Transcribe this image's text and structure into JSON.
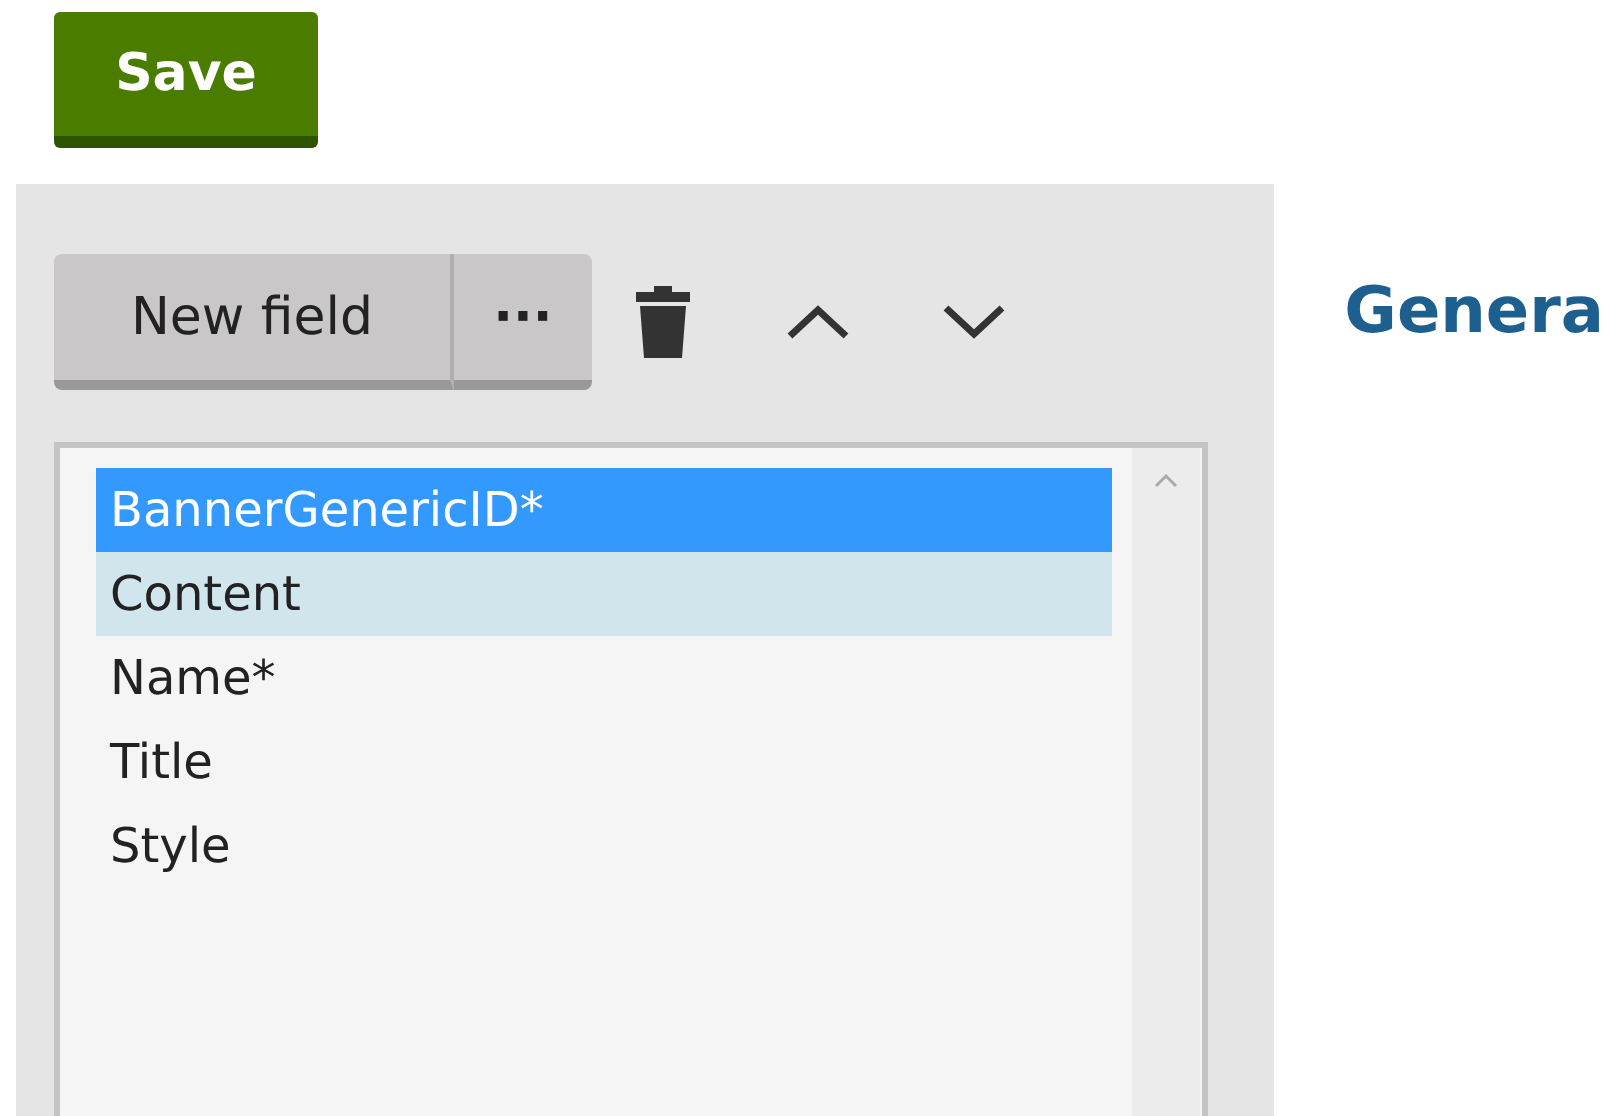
{
  "save_button": {
    "label": "Save"
  },
  "toolbar": {
    "new_field": "New field",
    "more": "···"
  },
  "heading": "Genera",
  "fields": [
    {
      "label": "BannerGenericID*",
      "selected": true,
      "highlighted": false
    },
    {
      "label": "Content",
      "selected": false,
      "highlighted": true
    },
    {
      "label": "Name*",
      "selected": false,
      "highlighted": false
    },
    {
      "label": "Title",
      "selected": false,
      "highlighted": false
    },
    {
      "label": "Style",
      "selected": false,
      "highlighted": false
    }
  ]
}
